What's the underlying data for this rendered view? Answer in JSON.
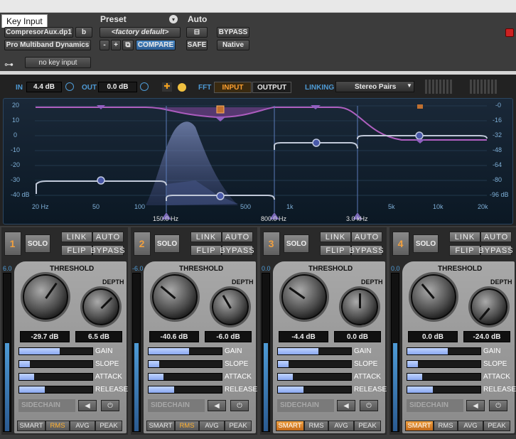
{
  "header": {
    "tab_key_input": "Key Input",
    "preset_label": "Preset",
    "auto_label": "Auto",
    "preset_file": "CompresorAux.dp1",
    "preset_slot": "b",
    "plugin_name": "Pro Multiband Dynamics",
    "preset_name": "<factory default>",
    "minus": "-",
    "plus": "+",
    "compare": "COMPARE",
    "bypass": "BYPASS",
    "safe": "SAFE",
    "native": "Native",
    "key_input_value": "no key input"
  },
  "io": {
    "in_label": "IN",
    "in_value": "4.4 dB",
    "out_label": "OUT",
    "out_value": "0.0 dB",
    "fft_label": "FFT",
    "fft_input": "INPUT",
    "fft_output": "OUTPUT",
    "linking_label": "LINKING",
    "linking_value": "Stereo Pairs"
  },
  "graph": {
    "left_axis": [
      "20",
      "10",
      "0",
      "-10",
      "-20",
      "-30",
      "-40 dB"
    ],
    "right_axis": [
      "-0",
      "-16",
      "-32",
      "-48",
      "-64",
      "-80",
      "-96 dB"
    ],
    "freq_ticks": [
      "20 Hz",
      "50",
      "100",
      "500",
      "1k",
      "5k",
      "10k",
      "20k"
    ],
    "crossovers": [
      "150.0 Hz",
      "800.0 Hz",
      "3.0 kHz"
    ]
  },
  "bands": [
    {
      "num": "1",
      "solo": "SOLO",
      "link": "LINK",
      "auto": "AUTO",
      "flip": "FLIP",
      "bypass": "BYPASS",
      "meter": "6.0",
      "threshold_label": "THRESHOLD",
      "depth_label": "DEPTH",
      "threshold": "-29.7 dB",
      "depth": "6.5 dB",
      "gain": "GAIN",
      "slope": "SLOPE",
      "attack": "ATTACK",
      "release": "RELEASE",
      "sidechain": "SIDECHAIN",
      "smart": "SMART",
      "rms": "RMS",
      "avg": "AVG",
      "peak": "PEAK",
      "gain_level": 0.55,
      "slope_level": 0.15,
      "attack_level": 0.2,
      "release_level": 0.35,
      "active_mode": "rms"
    },
    {
      "num": "2",
      "solo": "SOLO",
      "link": "LINK",
      "auto": "AUTO",
      "flip": "FLIP",
      "bypass": "BYPASS",
      "meter": "-6.0",
      "threshold_label": "THRESHOLD",
      "depth_label": "DEPTH",
      "threshold": "-40.6 dB",
      "depth": "-6.0 dB",
      "gain": "GAIN",
      "slope": "SLOPE",
      "attack": "ATTACK",
      "release": "RELEASE",
      "sidechain": "SIDECHAIN",
      "smart": "SMART",
      "rms": "RMS",
      "avg": "AVG",
      "peak": "PEAK",
      "gain_level": 0.55,
      "slope_level": 0.15,
      "attack_level": 0.2,
      "release_level": 0.35,
      "active_mode": "rms"
    },
    {
      "num": "3",
      "solo": "SOLO",
      "link": "LINK",
      "auto": "AUTO",
      "flip": "FLIP",
      "bypass": "BYPASS",
      "meter": "0.0",
      "threshold_label": "THRESHOLD",
      "depth_label": "DEPTH",
      "threshold": "-4.4 dB",
      "depth": "0.0 dB",
      "gain": "GAIN",
      "slope": "SLOPE",
      "attack": "ATTACK",
      "release": "RELEASE",
      "sidechain": "SIDECHAIN",
      "smart": "SMART",
      "rms": "RMS",
      "avg": "AVG",
      "peak": "PEAK",
      "gain_level": 0.55,
      "slope_level": 0.15,
      "attack_level": 0.2,
      "release_level": 0.35,
      "active_mode": "smart"
    },
    {
      "num": "4",
      "solo": "SOLO",
      "link": "LINK",
      "auto": "AUTO",
      "flip": "FLIP",
      "bypass": "BYPASS",
      "meter": "0.0",
      "threshold_label": "THRESHOLD",
      "depth_label": "DEPTH",
      "threshold": "0.0 dB",
      "depth": "-24.0 dB",
      "gain": "GAIN",
      "slope": "SLOPE",
      "attack": "ATTACK",
      "release": "RELEASE",
      "sidechain": "SIDECHAIN",
      "smart": "SMART",
      "rms": "RMS",
      "avg": "AVG",
      "peak": "PEAK",
      "gain_level": 0.55,
      "slope_level": 0.15,
      "attack_level": 0.2,
      "release_level": 0.35,
      "active_mode": "smart"
    }
  ]
}
